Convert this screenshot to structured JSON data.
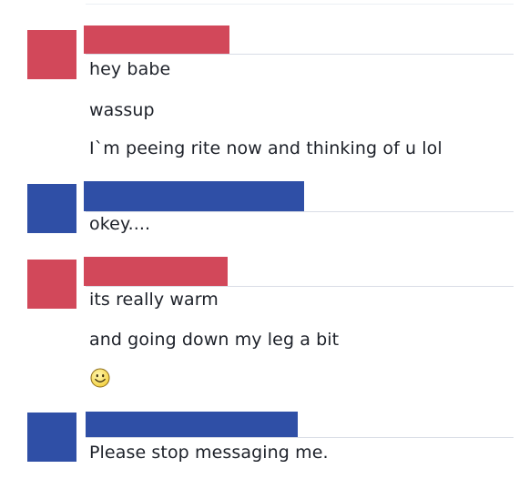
{
  "colors": {
    "sender_a": "#d2485a",
    "sender_b": "#2f4fa6"
  },
  "thread": [
    {
      "sender": "sender_a",
      "messages": [
        "hey babe",
        "wassup",
        "I`m peeing rite now and thinking of u lol"
      ]
    },
    {
      "sender": "sender_b",
      "messages": [
        "okey...."
      ]
    },
    {
      "sender": "sender_a",
      "messages": [
        "its really warm",
        "and going down my leg a bit"
      ],
      "emoji": "smiley-emoji"
    },
    {
      "sender": "sender_b",
      "messages": [
        "Please stop messaging me."
      ]
    }
  ]
}
